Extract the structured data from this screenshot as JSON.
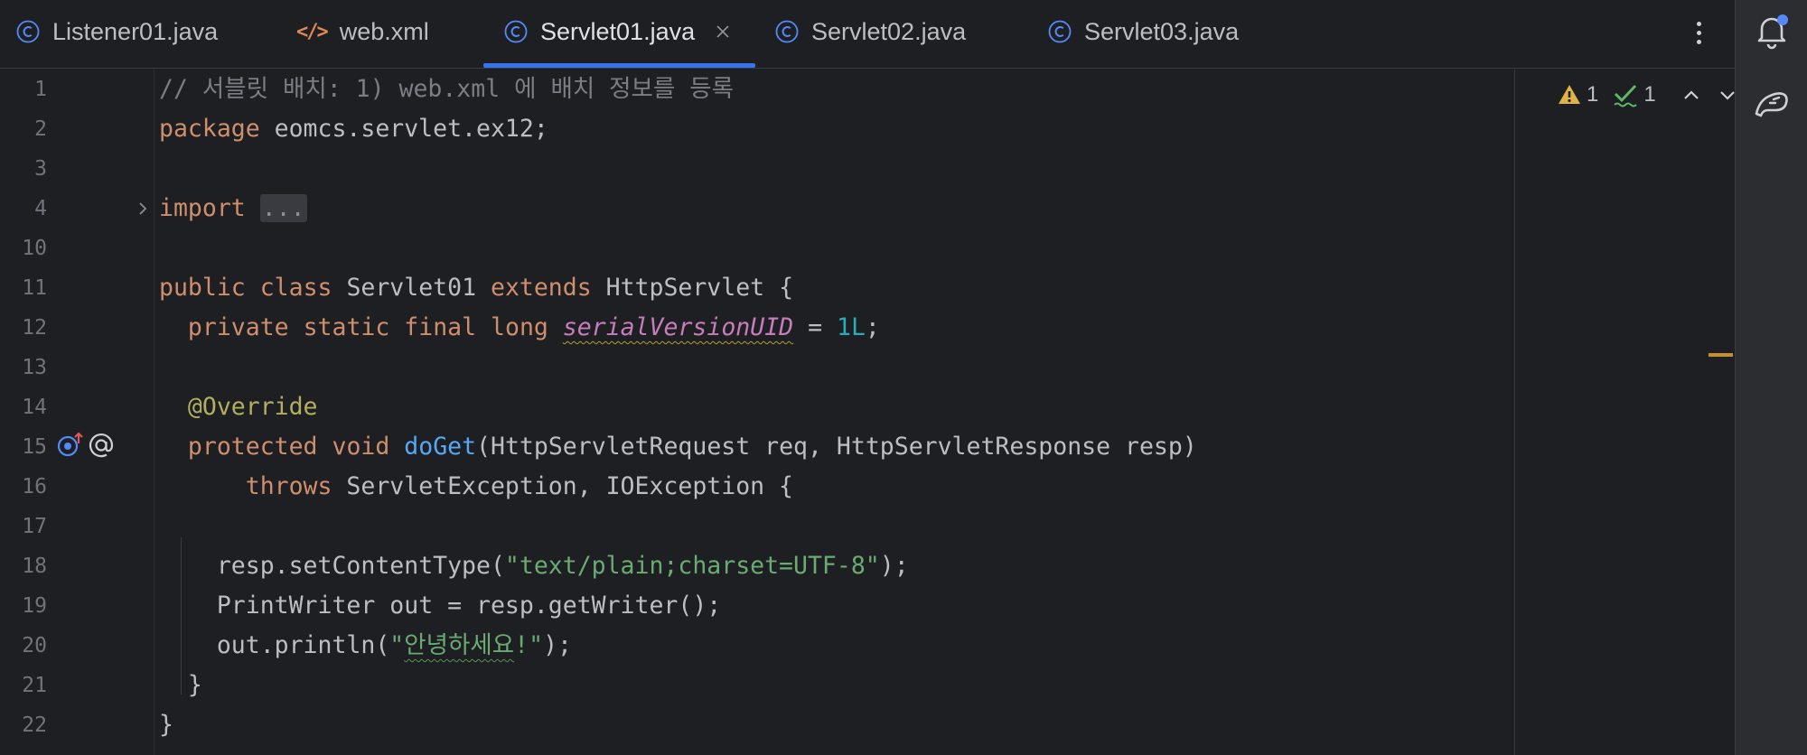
{
  "tabs": [
    {
      "label": "Listener01.java",
      "icon": "java-class-icon",
      "active": false
    },
    {
      "label": "web.xml",
      "icon": "xml-icon",
      "active": false
    },
    {
      "label": "Servlet01.java",
      "icon": "java-class-icon",
      "active": true
    },
    {
      "label": "Servlet02.java",
      "icon": "java-class-icon",
      "active": false
    },
    {
      "label": "Servlet03.java",
      "icon": "java-class-icon",
      "active": false
    }
  ],
  "icons": {
    "xml_glyph": "</>",
    "more": "more-vertical-icon",
    "notifications": "notification-bell-icon",
    "ai_assistant": "ai-assistant-icon",
    "overrides": "overrides-method-icon",
    "annotation": "annotation-icon",
    "fold": "fold-chevron-icon"
  },
  "colors": {
    "accent": "#3574f0",
    "keyword": "#cf8e6d",
    "comment": "#7a7e85",
    "string": "#6aab73",
    "number": "#2aacb8",
    "function": "#56a8f5",
    "annotation": "#b3ae60",
    "field": "#c77dbb",
    "warning": "#e0b347",
    "ok": "#5fb865"
  },
  "inspections": {
    "warnings": "1",
    "typos": "1"
  },
  "editor": {
    "lines": [
      {
        "num": "1",
        "parts": {
          "c": "// 서블릿 배치: 1) web.xml 에 배치 정보를 등록"
        }
      },
      {
        "num": "2",
        "parts": {
          "kw": "package",
          "rest": " eomcs.servlet.ex12;"
        }
      },
      {
        "num": "3"
      },
      {
        "num": "4",
        "parts": {
          "kw": "import",
          "sp": " ",
          "fold": "..."
        }
      },
      {
        "num": "10"
      },
      {
        "num": "11",
        "parts": {
          "kw1": "public",
          "sp1": " ",
          "kw2": "class",
          "t1": " Servlet01 ",
          "kw3": "extends",
          "t2": " HttpServlet {"
        }
      },
      {
        "num": "12",
        "parts": {
          "ind": "  ",
          "kw1": "private",
          "sp1": " ",
          "kw2": "static",
          "sp2": " ",
          "kw3": "final",
          "sp3": " ",
          "kw4": "long",
          "sp4": " ",
          "fld": "serialVersionUID",
          "t1": " = ",
          "num": "1L",
          "t2": ";"
        }
      },
      {
        "num": "13"
      },
      {
        "num": "14",
        "parts": {
          "ind": "  ",
          "an": "@Override"
        }
      },
      {
        "num": "15",
        "parts": {
          "ind": "  ",
          "kw1": "protected",
          "sp1": " ",
          "kw2": "void",
          "sp2": " ",
          "fn": "doGet",
          "t1": "(HttpServletRequest req, HttpServletResponse resp)"
        }
      },
      {
        "num": "16",
        "parts": {
          "ind": "      ",
          "kw": "throws",
          "t1": " ServletException, IOException {"
        }
      },
      {
        "num": "17"
      },
      {
        "num": "18",
        "parts": {
          "ind": "    ",
          "t1": "resp.setContentType(",
          "str": "\"text/plain;charset=UTF-8\"",
          "t2": ");"
        }
      },
      {
        "num": "19",
        "parts": {
          "ind": "    ",
          "t1": "PrintWriter out = resp.getWriter();"
        }
      },
      {
        "num": "20",
        "parts": {
          "ind": "    ",
          "t1": "out.println(",
          "q1": "\"",
          "str": "안녕하세요",
          "q2": "!\"",
          "t2": ");"
        }
      },
      {
        "num": "21",
        "parts": {
          "t1": "  }"
        }
      },
      {
        "num": "22",
        "parts": {
          "t1": "}"
        }
      }
    ]
  }
}
